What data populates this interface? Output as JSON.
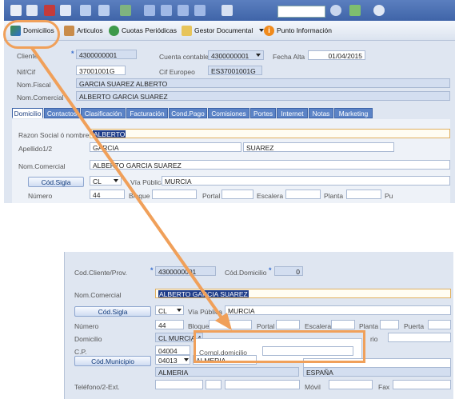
{
  "toolbar": {
    "domicilios_label": "Domicilios",
    "articulos_label": "Articulos",
    "cuotas_label": "Cuotas Periódicas",
    "gestor_label": "Gestor Documental",
    "punto_label": "Punto Información"
  },
  "header": {
    "cliente_label": "Cliente",
    "cliente_value": "4300000001",
    "cuenta_label": "Cuenta contable",
    "cuenta_value": "4300000001",
    "fecha_alta_label": "Fecha Alta",
    "fecha_alta_value": "01/04/2015",
    "nif_label": "Nif/Cif",
    "nif_value": "37001001G",
    "cif_eu_label": "Cif Europeo",
    "cif_eu_value": "ES37001001G",
    "nom_fiscal_label": "Nom.Fiscal",
    "nom_fiscal_value": "GARCIA SUAREZ ALBERTO",
    "nom_comercial_label": "Nom.Comercial",
    "nom_comercial_value": "ALBERTO GARCIA SUAREZ"
  },
  "tabs": [
    "Domicilio",
    "Contactos",
    "Clasificación",
    "Facturación",
    "Cond.Pago",
    "Comisiones",
    "Portes",
    "Internet",
    "Notas",
    "Marketing"
  ],
  "domicilio": {
    "razon_label": "Razon Social ó nombre",
    "razon_value": "ALBERTO",
    "apellido_label": "Apellido1/2",
    "apellido1_value": "GARCIA",
    "apellido2_value": "SUAREZ",
    "nom_comercial_label": "Nom.Comercial",
    "nom_comercial_value": "ALBERTO GARCIA SUAREZ",
    "cod_sigla_button": "Cód.Sigla",
    "sigla_value": "CL",
    "via_publica_label": "Vía Pública",
    "via_value": "MURCIA",
    "numero_label": "Número",
    "numero_value": "44",
    "bloque_label": "Bloque",
    "portal_label": "Portal",
    "escalera_label": "Escalera",
    "planta_label": "Planta",
    "puerta_label": "Pu"
  },
  "bottom": {
    "cod_cliente_label": "Cod.Cliente/Prov.",
    "cod_cliente_value": "4300000001",
    "cod_domicilio_label": "Cód.Domicilio",
    "cod_domicilio_value": "0",
    "nom_comercial_label": "Nom.Comercial",
    "nom_comercial_value": "ALBERTO GARCIA SUAREZ",
    "cod_sigla_button": "Cód.Sigla",
    "sigla_value": "CL",
    "via_publica_label": "Vía Pública",
    "via_value": "MURCIA",
    "numero_label": "Número",
    "numero_value": "44",
    "bloque_label": "Bloque",
    "portal_label": "Portal",
    "escalera_label": "Escalera",
    "planta_label": "Planta",
    "puerta_label": "Puerta",
    "domicilio_label": "Domicilio",
    "domicilio_value": "CL MURCIA,4",
    "rio_label": "rio",
    "cp_label": "C.P.",
    "cp_value": "04004",
    "compl_label": "Compl.domicilio",
    "cod_municipio_button": "Cód.Municipio",
    "municipio_value": "04013",
    "municipio_name": "ALMERIA",
    "provincia_value": "ALMERIA",
    "pais_value": "ESPAÑA",
    "telefono_label": "Teléfono/2-Ext.",
    "movil_label": "Móvil",
    "fax_label": "Fax"
  },
  "colors": {
    "accent": "#f0a05a",
    "toolbar_blue": "#4a6fb2",
    "selected": "#1f3d8a"
  }
}
